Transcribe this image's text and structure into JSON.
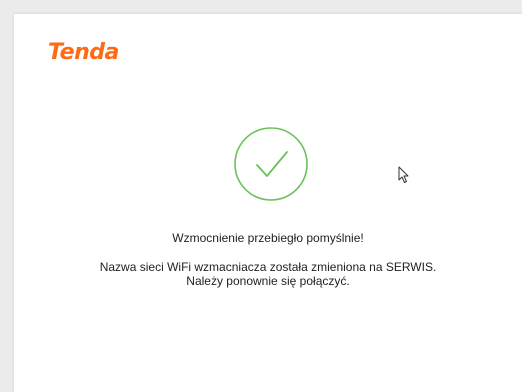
{
  "brand": {
    "logo_text": "Tenda",
    "accent_color": "#ff6a13"
  },
  "status": {
    "icon": "check-circle-icon",
    "icon_color": "#6ac259",
    "title": "Wzmocnienie przebiegło pomyślnie!",
    "message_line1": "Nazwa sieci WiFi wzmacniacza została zmieniona na SERWIS.",
    "message_line2": "Należy ponownie się połączyć."
  }
}
